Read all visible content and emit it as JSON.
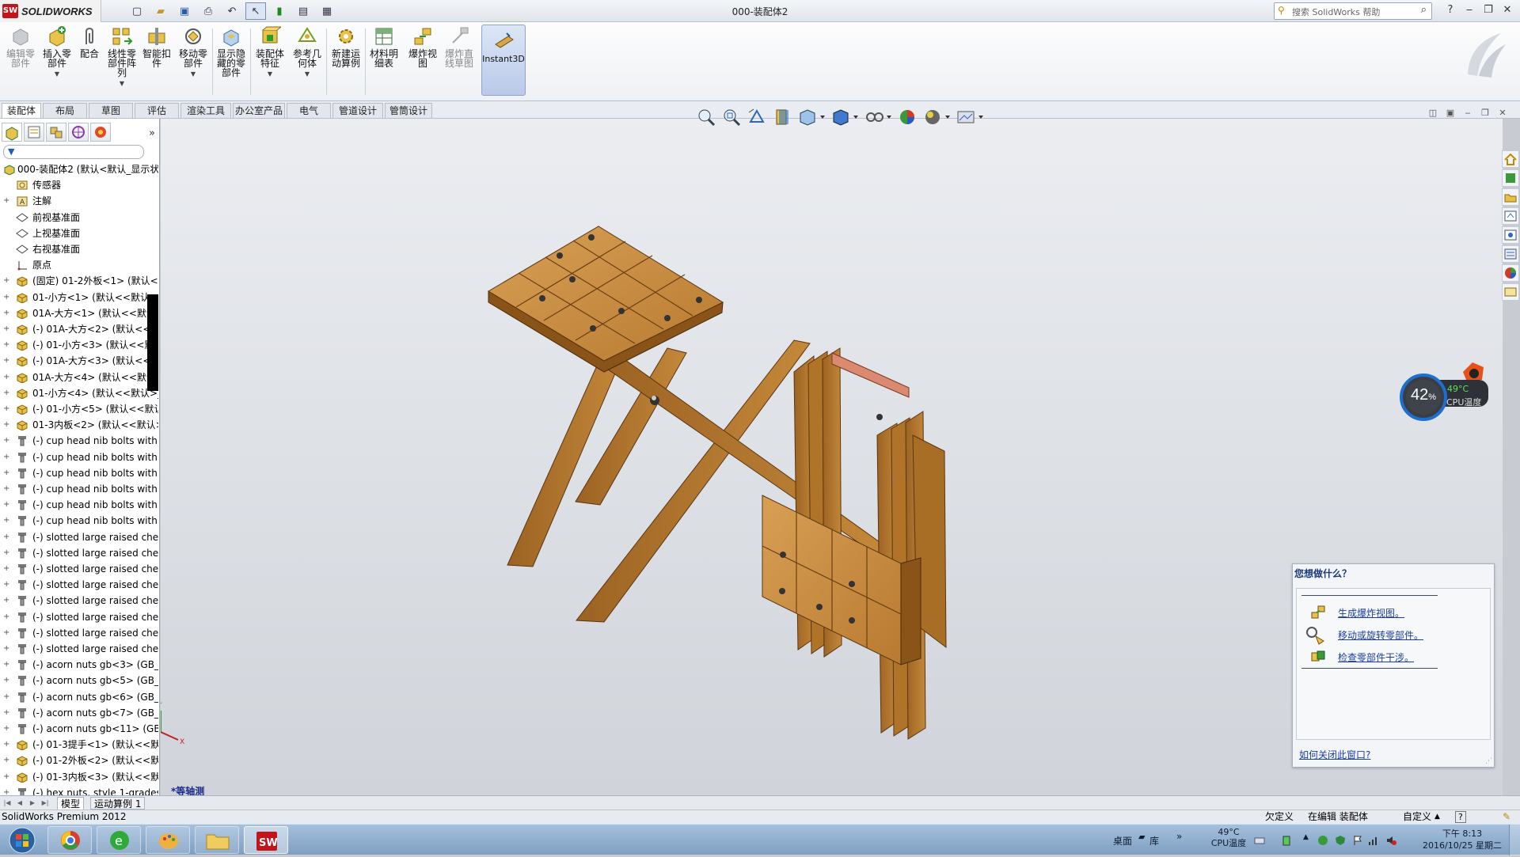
{
  "window": {
    "app_name": "SOLIDWORKS",
    "logo_mark": "SW",
    "title": "000-装配体2",
    "search_placeholder": "搜索 SolidWorks 帮助"
  },
  "ribbon": {
    "buttons": [
      {
        "label": "编辑零\n部件",
        "disabled": true
      },
      {
        "label": "插入零\n部件",
        "dropdown": true
      },
      {
        "label": "配合"
      },
      {
        "label": "线性零\n部件阵\n列",
        "dropdown": true
      },
      {
        "label": "智能扣\n件"
      },
      {
        "label": "移动零\n部件",
        "dropdown": true
      },
      {
        "label": "显示隐\n藏的零\n部件"
      },
      {
        "label": "装配体\n特征",
        "dropdown": true
      },
      {
        "label": "参考几\n何体",
        "dropdown": true
      },
      {
        "label": "新建运\n动算例"
      },
      {
        "label": "材料明\n细表"
      },
      {
        "label": "爆炸视\n图"
      },
      {
        "label": "爆炸直\n线草图",
        "disabled": true
      },
      {
        "label": "Instant3D",
        "active": true
      }
    ]
  },
  "command_tabs": [
    "装配体",
    "布局",
    "草图",
    "评估",
    "渲染工具",
    "办公室产品",
    "电气",
    "管道设计",
    "管筒设计"
  ],
  "feature_tree": {
    "root": "000-装配体2  (默认<默认_显示状",
    "items": [
      {
        "label": "传感器",
        "icon": "sensor-icon",
        "exp": ""
      },
      {
        "label": "注解",
        "icon": "annotation-icon",
        "exp": "+"
      },
      {
        "label": "前视基准面",
        "icon": "plane-icon",
        "exp": ""
      },
      {
        "label": "上视基准面",
        "icon": "plane-icon",
        "exp": ""
      },
      {
        "label": "右视基准面",
        "icon": "plane-icon",
        "exp": ""
      },
      {
        "label": "原点",
        "icon": "origin-icon",
        "exp": ""
      },
      {
        "label": "(固定) 01-2外板<1> (默认<<",
        "icon": "part-icon",
        "exp": "+"
      },
      {
        "label": "01-小方<1> (默认<<默认>_",
        "icon": "part-icon",
        "exp": "+"
      },
      {
        "label": "01A-大方<1> (默认<<默认>",
        "icon": "part-icon",
        "exp": "+"
      },
      {
        "label": "(-) 01A-大方<2> (默认<<默认",
        "icon": "part-icon",
        "exp": "+"
      },
      {
        "label": "(-) 01-小方<3> (默认<<默认",
        "icon": "part-icon",
        "exp": "+"
      },
      {
        "label": "(-) 01A-大方<3> (默认<<默认",
        "icon": "part-icon",
        "exp": "+"
      },
      {
        "label": "01A-大方<4> (默认<<默认>",
        "icon": "part-icon",
        "exp": "+"
      },
      {
        "label": "01-小方<4> (默认<<默认>_",
        "icon": "part-icon",
        "exp": "+"
      },
      {
        "label": "(-) 01-小方<5> (默认<<默认",
        "icon": "part-icon",
        "exp": "+"
      },
      {
        "label": "01-3内板<2> (默认<<默认>",
        "icon": "part-icon",
        "exp": "+"
      },
      {
        "label": "(-) cup head nib bolts with",
        "icon": "fastener-icon",
        "exp": "+"
      },
      {
        "label": "(-) cup head nib bolts with",
        "icon": "fastener-icon",
        "exp": "+"
      },
      {
        "label": "(-) cup head nib bolts with",
        "icon": "fastener-icon",
        "exp": "+"
      },
      {
        "label": "(-) cup head nib bolts with",
        "icon": "fastener-icon",
        "exp": "+"
      },
      {
        "label": "(-) cup head nib bolts with",
        "icon": "fastener-icon",
        "exp": "+"
      },
      {
        "label": "(-) cup head nib bolts with",
        "icon": "fastener-icon",
        "exp": "+"
      },
      {
        "label": "(-) slotted large raised chee",
        "icon": "fastener-icon",
        "exp": "+"
      },
      {
        "label": "(-) slotted large raised chee",
        "icon": "fastener-icon",
        "exp": "+"
      },
      {
        "label": "(-) slotted large raised chee",
        "icon": "fastener-icon",
        "exp": "+"
      },
      {
        "label": "(-) slotted large raised chee",
        "icon": "fastener-icon",
        "exp": "+"
      },
      {
        "label": "(-) slotted large raised chee",
        "icon": "fastener-icon",
        "exp": "+"
      },
      {
        "label": "(-) slotted large raised chee",
        "icon": "fastener-icon",
        "exp": "+"
      },
      {
        "label": "(-) slotted large raised chee",
        "icon": "fastener-icon",
        "exp": "+"
      },
      {
        "label": "(-) slotted large raised chee",
        "icon": "fastener-icon",
        "exp": "+"
      },
      {
        "label": "(-) acorn nuts gb<3> (GB_S",
        "icon": "fastener-icon",
        "exp": "+"
      },
      {
        "label": "(-) acorn nuts gb<5> (GB_S",
        "icon": "fastener-icon",
        "exp": "+"
      },
      {
        "label": "(-) acorn nuts gb<6> (GB_S",
        "icon": "fastener-icon",
        "exp": "+"
      },
      {
        "label": "(-) acorn nuts gb<7> (GB_S",
        "icon": "fastener-icon",
        "exp": "+"
      },
      {
        "label": "(-) acorn nuts gb<11> (GB_",
        "icon": "fastener-icon",
        "exp": "+"
      },
      {
        "label": "(-) 01-3提手<1> (默认<<默认",
        "icon": "part-icon",
        "exp": "+"
      },
      {
        "label": "(-) 01-2外板<2> (默认<<默认",
        "icon": "part-icon",
        "exp": "+"
      },
      {
        "label": "(-) 01-3内板<3> (默认<<默认",
        "icon": "part-icon",
        "exp": "+"
      },
      {
        "label": "(-) hex nuts, style 1-grades",
        "icon": "fastener-icon",
        "exp": "+"
      }
    ]
  },
  "viewport": {
    "view_label": "*等轴测",
    "colors": {
      "wood": "#c4883a",
      "wood_dark": "#7a4a16",
      "handle": "#d98a70",
      "bg": "#e3e6ea"
    }
  },
  "cpu_widget": {
    "percent": "42",
    "percent_sign": "%",
    "temp": "49°C",
    "label": "CPU温度"
  },
  "popup": {
    "title": "您想做什么？",
    "links": [
      "生成爆炸视图。",
      "移动或旋转零部件。",
      "检查零部件干涉。"
    ],
    "close_help": "如何关闭此窗口?"
  },
  "bottom_tabs": [
    "模型",
    "运动算例 1"
  ],
  "status": {
    "product": "SolidWorks Premium 2012",
    "state": "欠定义",
    "editing": "在编辑 装配体",
    "custom": "自定义",
    "help": "?"
  },
  "taskbar": {
    "desktop": "桌面",
    "library": "库",
    "chevron": "»",
    "temp": "49°C",
    "temp_label": "CPU温度",
    "time": "下午 8:13",
    "date": "2016/10/25 星期二"
  }
}
